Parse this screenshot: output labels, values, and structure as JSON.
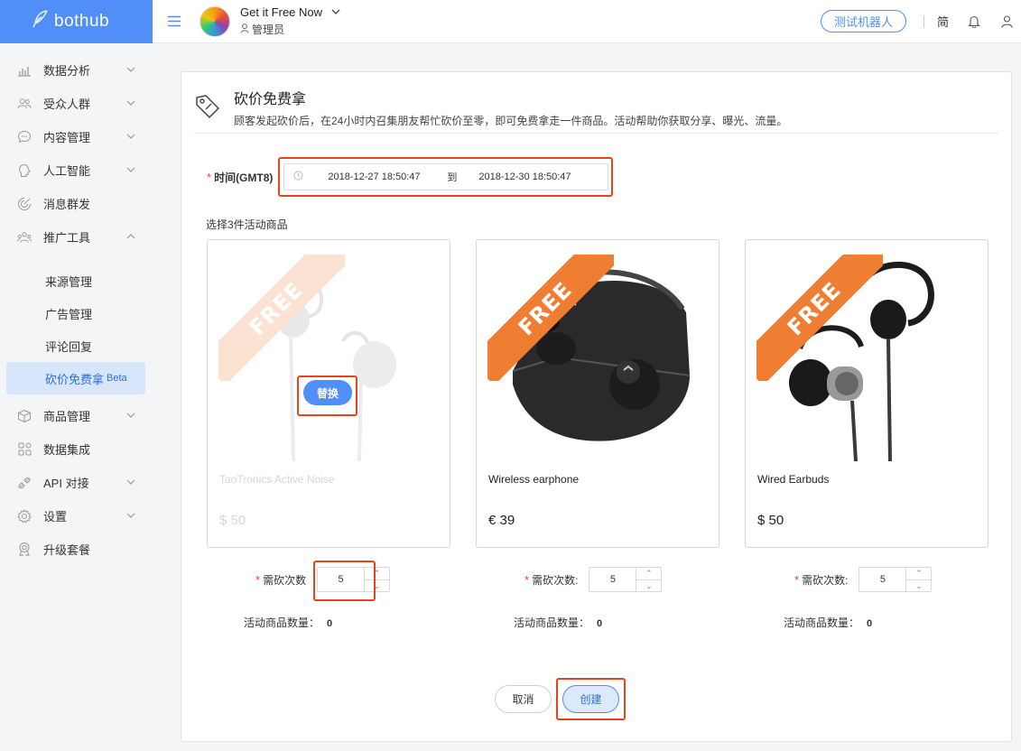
{
  "brand": {
    "logo_text": "bothub"
  },
  "header": {
    "app_name": "Get it Free Now",
    "role": "管理员",
    "bot_button": "测试机器人",
    "lang": "简"
  },
  "sidebar": {
    "items": [
      {
        "label": "数据分析",
        "icon": "chart-icon",
        "has_arrow": true
      },
      {
        "label": "受众人群",
        "icon": "users-icon",
        "has_arrow": true
      },
      {
        "label": "内容管理",
        "icon": "chat-icon",
        "has_arrow": true
      },
      {
        "label": "人工智能",
        "icon": "brain-icon",
        "has_arrow": true
      },
      {
        "label": "消息群发",
        "icon": "broadcast-icon",
        "has_arrow": false
      },
      {
        "label": "推广工具",
        "icon": "promotion-icon",
        "has_arrow": true,
        "expanded": true
      }
    ],
    "sub_items": [
      {
        "label": "来源管理"
      },
      {
        "label": "广告管理"
      },
      {
        "label": "评论回复"
      },
      {
        "label": "砍价免费拿",
        "beta": "Beta",
        "active": true
      }
    ],
    "items_after": [
      {
        "label": "商品管理",
        "icon": "box-icon",
        "has_arrow": true
      },
      {
        "label": "数据集成",
        "icon": "grid-icon",
        "has_arrow": false
      },
      {
        "label": "API 对接",
        "icon": "api-icon",
        "has_arrow": true
      },
      {
        "label": "设置",
        "icon": "gear-icon",
        "has_arrow": true
      },
      {
        "label": "升级套餐",
        "icon": "upgrade-icon",
        "has_arrow": false
      }
    ]
  },
  "page": {
    "title": "砍价免费拿",
    "description": "顾客发起砍价后，在24小时内召集朋友帮忙砍价至零，即可免费拿走一件商品。活动帮助你获取分享、曝光、流量。",
    "time_label": "时间(GMT8)",
    "start_time": "2018-12-27 18:50:47",
    "to_text": "到",
    "end_time": "2018-12-30 18:50:47",
    "select_title": "选择3件活动商品",
    "ribbon_text": "FREE",
    "replace_label": "替换",
    "products": [
      {
        "name": "TaoTronics Active Noise",
        "price": "$ 50",
        "cut_label": "需砍次数",
        "cut_value": "5",
        "count_label": "活动商品数量：",
        "count_value": "0"
      },
      {
        "name": "Wireless earphone",
        "price": "€ 39",
        "cut_label": "需砍次数:",
        "cut_value": "5",
        "count_label": "活动商品数量：",
        "count_value": "0"
      },
      {
        "name": "Wired Earbuds",
        "price": "$ 50",
        "cut_label": "需砍次数:",
        "cut_value": "5",
        "count_label": "活动商品数量：",
        "count_value": "0"
      }
    ],
    "cancel_label": "取消",
    "create_label": "创建"
  },
  "colors": {
    "accent": "#4f8ff7",
    "ribbon": "#ef7d32",
    "highlight": "#e8431b"
  }
}
